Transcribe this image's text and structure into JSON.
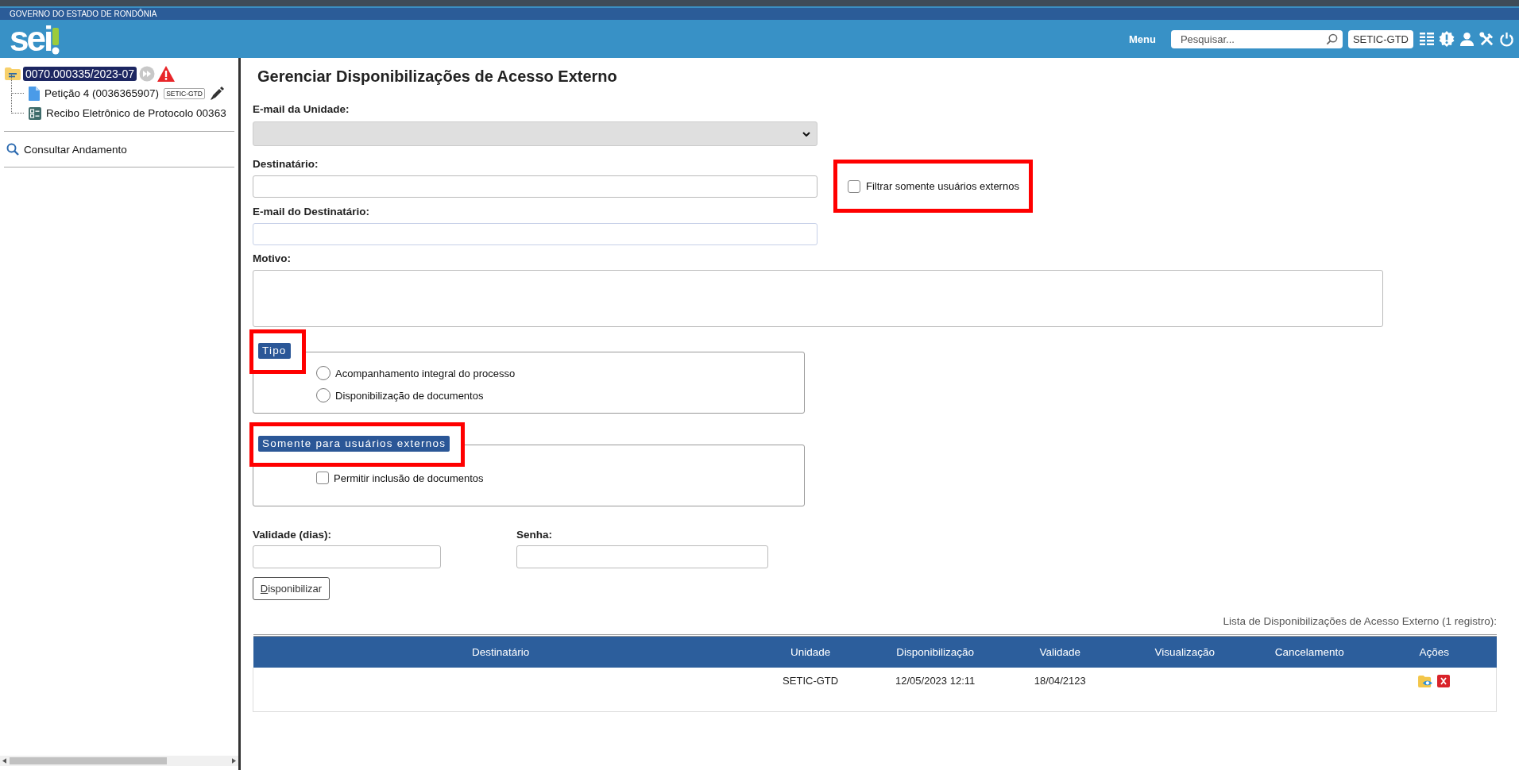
{
  "top_bar": {
    "title": "GOVERNO DO ESTADO DE RONDÔNIA"
  },
  "header": {
    "logo": "sei",
    "menu_label": "Menu",
    "search": {
      "placeholder": "Pesquisar..."
    },
    "unit": "SETIC-GTD"
  },
  "sidebar": {
    "process": {
      "number": "0070.000335/2023-07",
      "selected": true,
      "children": [
        {
          "kind": "document",
          "label": "Petição 4 (0036365907)",
          "tag": "SETIC-GTD"
        },
        {
          "kind": "receipt",
          "label": "Recibo Eletrônico de Protocolo 00363"
        }
      ]
    },
    "actions": [
      {
        "label": "Consultar Andamento"
      }
    ]
  },
  "form": {
    "title": "Gerenciar Disponibilizações de Acesso Externo",
    "unit_email": {
      "label": "E-mail da Unidade:",
      "disabled": true
    },
    "recipient": {
      "label": "Destinatário:"
    },
    "filter": {
      "label": "Filtrar somente usuários externos",
      "checked": false,
      "highlighted": true
    },
    "recipient_email": {
      "label": "E-mail do Destinatário:"
    },
    "reason": {
      "label": "Motivo:"
    },
    "fieldsets": [
      {
        "legend": "Tipo",
        "highlighted": true,
        "kind": "radio",
        "options": [
          {
            "label": "Acompanhamento integral do processo",
            "selected": false
          },
          {
            "label": "Disponibilização de documentos",
            "selected": false
          }
        ]
      },
      {
        "legend": "Somente para usuários externos",
        "highlighted": true,
        "kind": "checkbox",
        "options": [
          {
            "label": "Permitir inclusão de documentos",
            "checked": false
          }
        ]
      }
    ],
    "validity": {
      "label": "Validade (dias):"
    },
    "password": {
      "label": "Senha:"
    },
    "submit": "Disponibilizar"
  },
  "table": {
    "caption": "Lista de Disponibilizações de Acesso Externo (1 registro):",
    "columns": [
      "Destinatário",
      "Unidade",
      "Disponibilização",
      "Validade",
      "Visualização",
      "Cancelamento",
      "Ações"
    ],
    "rows": [
      {
        "unit": "SETIC-GTD",
        "available_since": "12/05/2023 12:11",
        "valid_until": "18/04/2123",
        "actions": [
          {
            "kind": "view"
          },
          {
            "kind": "cancel"
          }
        ]
      }
    ]
  }
}
